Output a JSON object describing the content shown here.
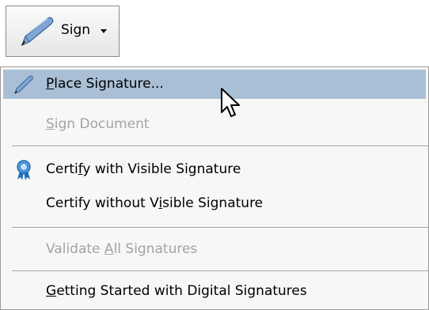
{
  "toolbar": {
    "sign_button": {
      "label": "Sign",
      "icon": "pen-icon",
      "dropdown_icon": "caret-down-icon"
    }
  },
  "menu": {
    "items": [
      {
        "pre": "",
        "ul": "P",
        "post": "lace Signature...",
        "state": "highlighted",
        "icon": "pen-icon"
      },
      {
        "pre": "",
        "ul": "S",
        "post": "ign Document",
        "state": "disabled"
      },
      {
        "pre": "Certi",
        "ul": "f",
        "post": "y with Visible Signature",
        "state": "enabled",
        "icon": "ribbon-icon"
      },
      {
        "pre": "Certify without V",
        "ul": "i",
        "post": "sible Signature",
        "state": "enabled"
      },
      {
        "pre": "Validate ",
        "ul": "A",
        "post": "ll Signatures",
        "state": "disabled"
      },
      {
        "pre": "",
        "ul": "G",
        "post": "etting Started with Digital Signatures",
        "state": "enabled"
      }
    ]
  },
  "colors": {
    "highlight": "#a9bfd6",
    "disabled_text": "#a3a3a3",
    "menu_background": "#f7f7f7"
  }
}
